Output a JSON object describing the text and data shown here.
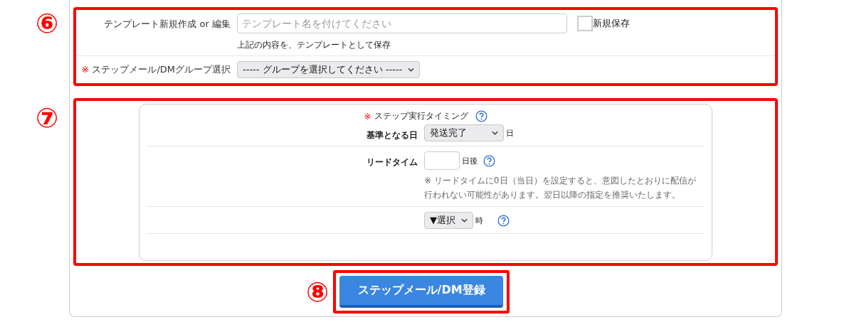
{
  "template": {
    "label": "テンプレート新規作成 or 編集",
    "name_field": {
      "placeholder": "テンプレート名を付けてください"
    },
    "save_as_new": {
      "label": "新規保存",
      "checked": false
    },
    "hint": "上記の内容を、テンプレートとして保存"
  },
  "group": {
    "required_mark": "※",
    "label": "ステップメール/DMグループ選択",
    "select": "----- グループを選択してください -----"
  },
  "timing": {
    "required_mark": "※",
    "title": "ステップ実行タイミング",
    "help": true,
    "rows": [
      {
        "kind": "select",
        "label": "基準となる日",
        "value": "発送完了",
        "suffix": "日",
        "help": false
      },
      {
        "kind": "input",
        "label": "リードタイム",
        "suffix": "日後",
        "help": true,
        "note": "※ リードタイムに0日（当日）を設定すると、意図したとおりに配信が行われない可能性があります。翌日以降の指定を推奨いたします。"
      },
      {
        "kind": "select",
        "value": "▼選択",
        "suffix": "時",
        "help": true
      }
    ]
  },
  "submit": "ステップメール/DM登録",
  "annotations": [
    "⑥",
    "⑦",
    "⑧"
  ]
}
